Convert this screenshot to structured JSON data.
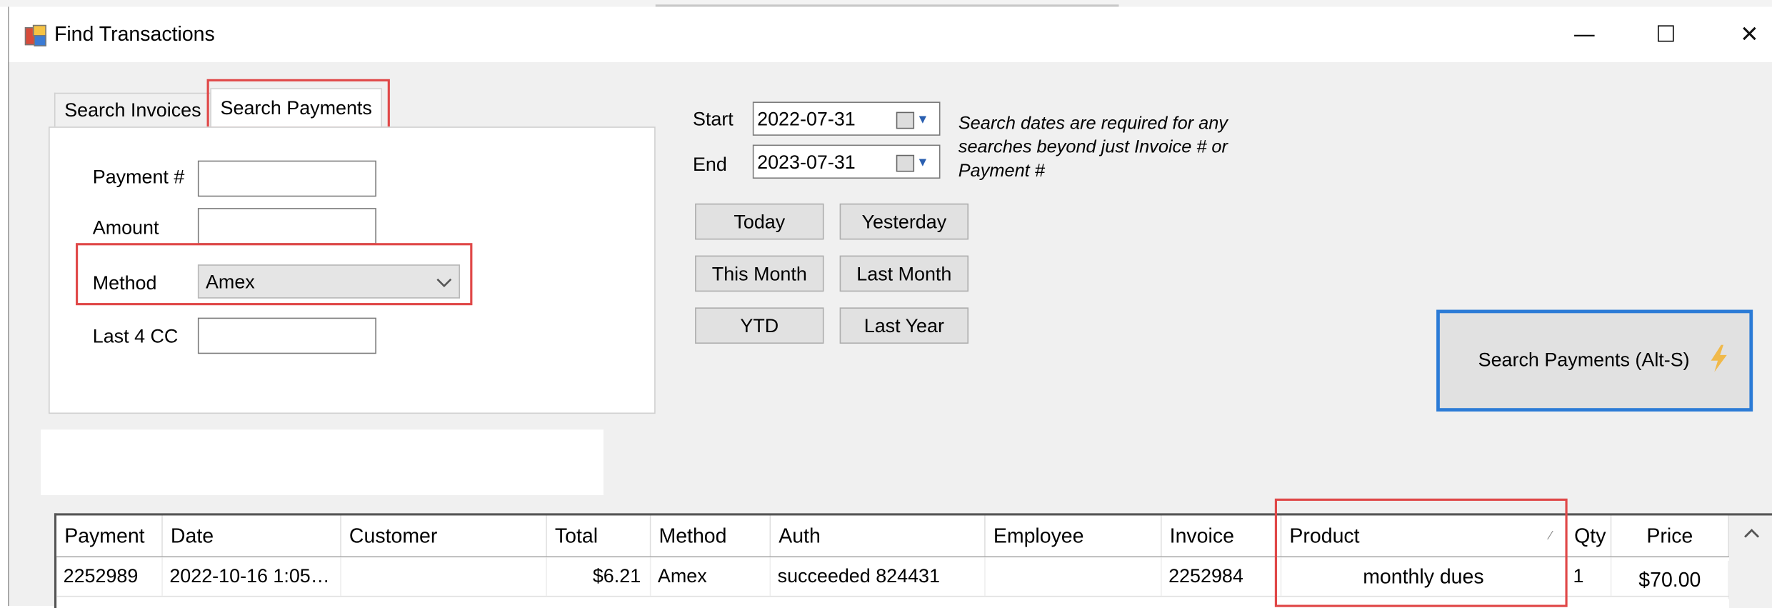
{
  "window": {
    "title": "Find Transactions",
    "minimize": "—",
    "maximize": "☐",
    "close": "✕"
  },
  "tabs": {
    "invoices": "Search Invoices",
    "payments": "Search Payments"
  },
  "form": {
    "payment_label": "Payment #",
    "payment_value": "",
    "amount_label": "Amount",
    "amount_value": "",
    "method_label": "Method",
    "method_value": "Amex",
    "last4_label": "Last 4 CC",
    "last4_value": ""
  },
  "dates": {
    "start_label": "Start",
    "start_value": "2022-07-31",
    "end_label": "End",
    "end_value": "2023-07-31",
    "note": "Search dates are required for any searches beyond just Invoice # or Payment #"
  },
  "quick": {
    "today": "Today",
    "yesterday": "Yesterday",
    "this_month": "This Month",
    "last_month": "Last Month",
    "ytd": "YTD",
    "last_year": "Last Year"
  },
  "search_button": "Search Payments (Alt-S)",
  "grid": {
    "columns": [
      "Payment",
      "Date",
      "Customer",
      "Total",
      "Method",
      "Auth",
      "Employee",
      "Invoice",
      "Product",
      "Qty",
      "Price"
    ],
    "rows": [
      [
        "2252989",
        "2022-10-16 1:05…",
        "",
        "$6.21",
        "Amex",
        "succeeded 824431",
        "",
        "2252984",
        "monthly dues",
        "1",
        "$70.00"
      ]
    ]
  },
  "colors": {
    "highlight": "#e04848",
    "focus": "#2b7bd6",
    "bolt": "#f0b94a"
  },
  "icons": {
    "app": "app-icon",
    "calendar": "calendar-icon",
    "dropdown": "chevron-down-icon",
    "bolt": "lightning-icon",
    "sort": "sort-icon",
    "scroll_up": "scroll-up-icon"
  }
}
